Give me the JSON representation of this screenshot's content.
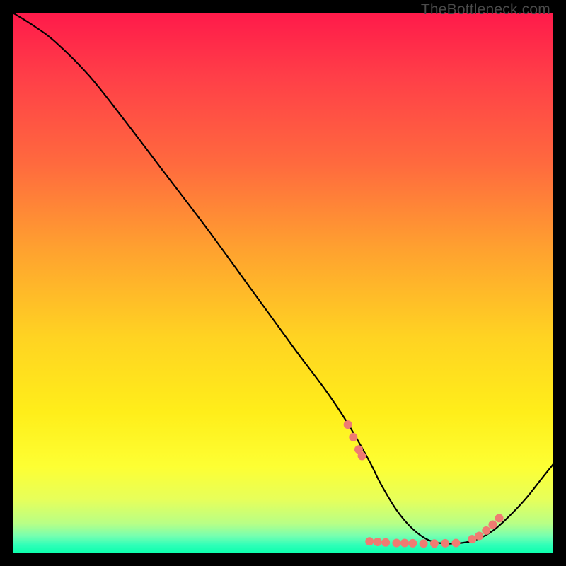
{
  "watermark": "TheBottleneck.com",
  "chart_data": {
    "type": "line",
    "title": "",
    "xlabel": "",
    "ylabel": "",
    "xlim": [
      0,
      100
    ],
    "ylim": [
      0,
      100
    ],
    "gradient_stops": [
      {
        "offset": 0.0,
        "color": "#ff1a4a"
      },
      {
        "offset": 0.12,
        "color": "#ff3f48"
      },
      {
        "offset": 0.28,
        "color": "#ff6a3e"
      },
      {
        "offset": 0.44,
        "color": "#ffa22f"
      },
      {
        "offset": 0.6,
        "color": "#ffd322"
      },
      {
        "offset": 0.74,
        "color": "#ffee1a"
      },
      {
        "offset": 0.84,
        "color": "#fdff33"
      },
      {
        "offset": 0.9,
        "color": "#e7ff5a"
      },
      {
        "offset": 0.945,
        "color": "#b8ff86"
      },
      {
        "offset": 0.968,
        "color": "#76ffb0"
      },
      {
        "offset": 0.985,
        "color": "#2fffb8"
      },
      {
        "offset": 1.0,
        "color": "#0affac"
      }
    ],
    "series": [
      {
        "name": "curve",
        "color": "#000000",
        "x": [
          0,
          4,
          8,
          14,
          20,
          28,
          36,
          44,
          52,
          58,
          62,
          66,
          68,
          71,
          74,
          77,
          80,
          83,
          86,
          89,
          92,
          95,
          98,
          100
        ],
        "y": [
          100,
          97.5,
          94.5,
          88.5,
          81,
          70.5,
          60,
          49,
          38,
          30,
          24,
          17,
          13,
          8,
          4.5,
          2.4,
          1.8,
          1.9,
          2.6,
          4.3,
          7.0,
          10.2,
          14,
          16.5
        ]
      }
    ],
    "markers": {
      "color": "#ef7b72",
      "radius_px": 6,
      "points_xy": [
        [
          62,
          23.8
        ],
        [
          63,
          21.5
        ],
        [
          64,
          19.2
        ],
        [
          64.6,
          18.0
        ],
        [
          66,
          2.2
        ],
        [
          67.5,
          2.1
        ],
        [
          69,
          2.0
        ],
        [
          71,
          1.9
        ],
        [
          72.5,
          1.9
        ],
        [
          74,
          1.85
        ],
        [
          76,
          1.8
        ],
        [
          78,
          1.8
        ],
        [
          80,
          1.85
        ],
        [
          82,
          1.9
        ],
        [
          85,
          2.6
        ],
        [
          86.3,
          3.2
        ],
        [
          87.6,
          4.2
        ],
        [
          88.8,
          5.3
        ],
        [
          90,
          6.5
        ]
      ]
    }
  }
}
